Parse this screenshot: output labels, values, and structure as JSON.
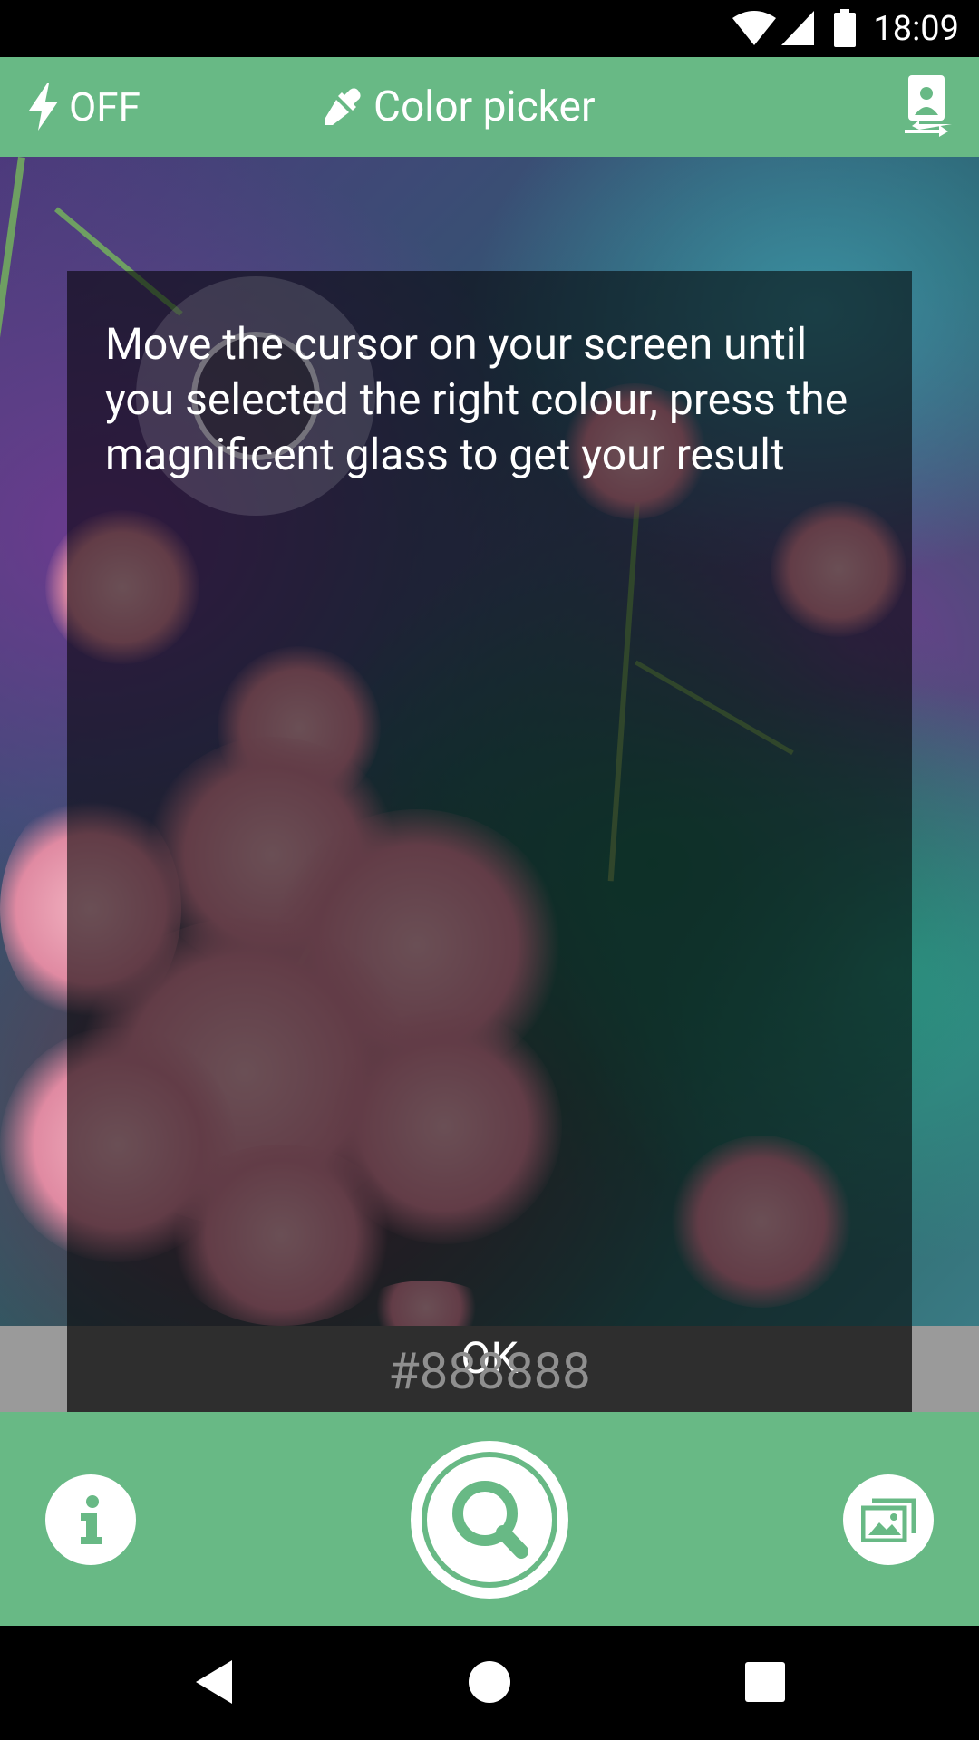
{
  "status_bar": {
    "time": "18:09",
    "icons": [
      "wifi-icon",
      "cell-signal-icon",
      "battery-icon"
    ]
  },
  "toolbar": {
    "flash_label": "OFF",
    "flash_icon": "lightning-bolt-icon",
    "title": "Color picker",
    "title_icon": "eyedropper-icon",
    "camera_switch_icon": "switch-camera-icon"
  },
  "tutorial": {
    "message": "Move the cursor on your screen until you selected the right colour, press the magnificent glass to get your result",
    "ok_label": "OK"
  },
  "color_result": {
    "hex": "#888888"
  },
  "bottom_bar": {
    "info_icon": "info-icon",
    "search_icon": "magnifier-icon",
    "gallery_icon": "gallery-icon"
  },
  "nav_bar": {
    "buttons": [
      "back-icon",
      "home-icon",
      "recents-icon"
    ]
  },
  "colors": {
    "accent": "#68b985",
    "status_bar": "#000000",
    "overlay": "rgba(0,0,0,0.56)",
    "hex_strip": "#9a9a9a"
  }
}
